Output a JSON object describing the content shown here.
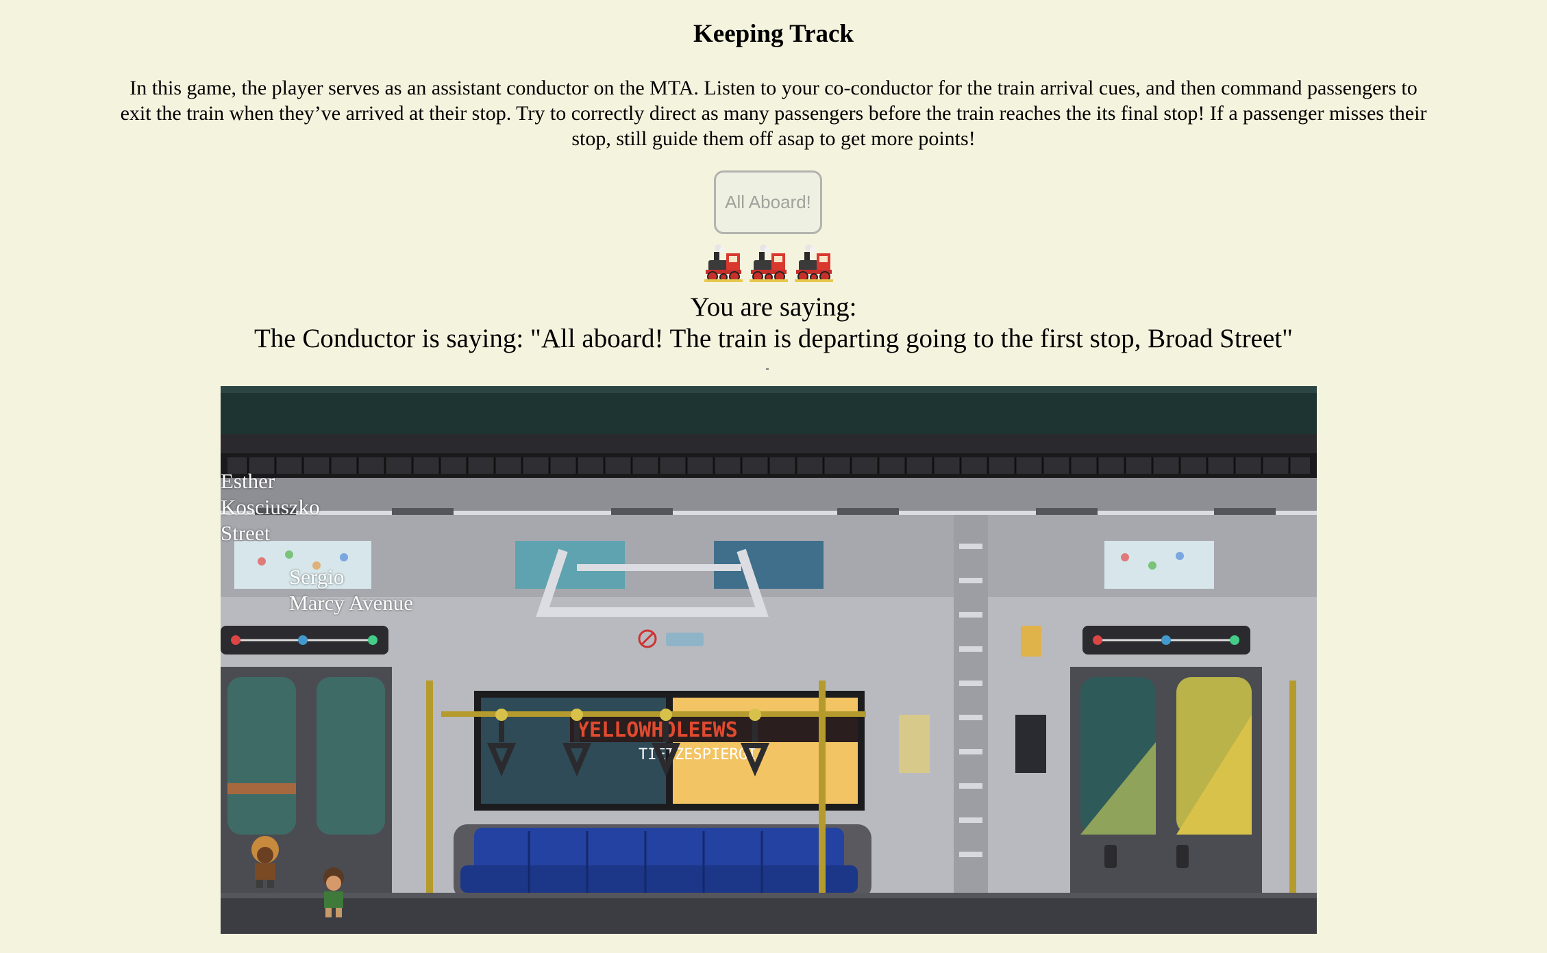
{
  "page": {
    "title": "Keeping Track",
    "intro": "In this game, the player serves as an assistant conductor on the MTA. Listen to your co-conductor for the train arrival cues, and then command passengers to exit the train when they’ve arrived at their stop. Try to correctly direct as many passengers before the train reaches the its final stop! If a passenger misses their stop, still guide them off asap to get more points!"
  },
  "controls": {
    "all_aboard_label": "All Aboard!"
  },
  "indicators": {
    "train_icons": [
      "steam-locomotive-icon",
      "steam-locomotive-icon",
      "steam-locomotive-icon"
    ]
  },
  "dialogue": {
    "you_saying": "You are saying:",
    "conductor_saying": "The Conductor is saying: \"All aboard! The train is departing going to the first stop, Broad Street\""
  },
  "passengers": [
    {
      "name": "Esther",
      "destination_line1": "Kosciuszko",
      "destination_line2": "Street"
    },
    {
      "name": "Sergio",
      "destination_line1": "Marcy Avenue"
    }
  ],
  "scene_sign": {
    "marquee_text": "YELLOWHOLEEWS",
    "sub_text": "TIETZESPIERGI"
  }
}
